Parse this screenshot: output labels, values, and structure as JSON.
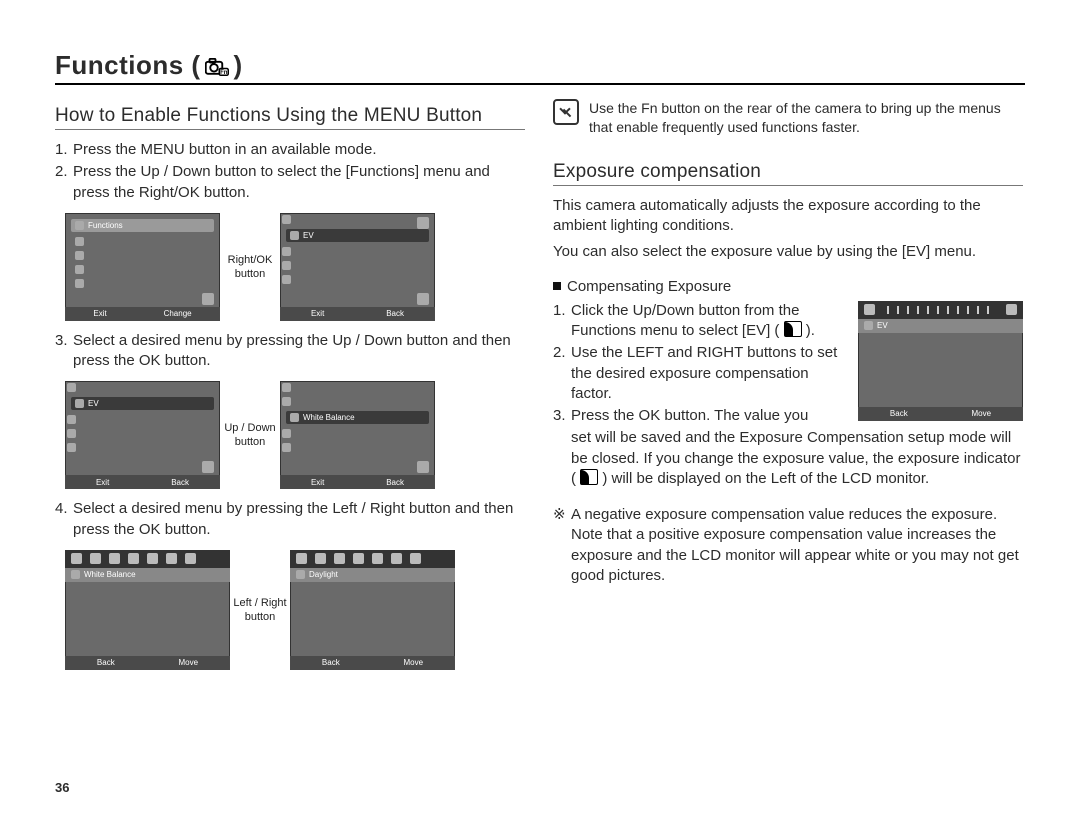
{
  "page_number": "36",
  "title": {
    "text": "Functions (",
    "icon_name": "camera-fn-icon",
    "close": ")"
  },
  "left": {
    "subhead": "How to Enable Functions Using the MENU Button",
    "steps": {
      "s1": "Press the MENU button in an available mode.",
      "s2": "Press the Up / Down button to select the [Functions] menu and press the Right/OK button.",
      "s3": "Select a desired menu by pressing the Up / Down button and then press the OK button.",
      "s4": "Select a desired menu by pressing the Left / Right button and then press the OK button."
    },
    "ann": {
      "rightok_l1": "Right/OK",
      "rightok_l2": "button",
      "updown_l1": "Up / Down",
      "updown_l2": "button",
      "leftright_l1": "Left / Right",
      "leftright_l2": "button"
    },
    "screens": {
      "a": {
        "title": "Functions",
        "footer_left": "Exit",
        "footer_right": "Change"
      },
      "b": {
        "title": "EV",
        "footer_left": "Exit",
        "footer_right": "Back"
      },
      "c": {
        "title": "EV",
        "footer_left": "Exit",
        "footer_right": "Back"
      },
      "d": {
        "title": "White Balance",
        "footer_left": "Exit",
        "footer_right": "Back"
      },
      "e": {
        "menubar": "White Balance",
        "footer_left": "Back",
        "footer_right": "Move"
      },
      "f": {
        "menubar": "Daylight",
        "footer_left": "Back",
        "footer_right": "Move"
      }
    }
  },
  "right": {
    "note": "Use the Fn button on the rear of the camera to bring up the menus that enable frequently used functions faster.",
    "subhead": "Exposure compensation",
    "intro1": "This camera automatically adjusts the exposure according to the ambient lighting conditions.",
    "intro2": "You can also select the exposure value by using the [EV] menu.",
    "bullet": "Compensating Exposure",
    "steps": {
      "s1a": "Click the Up/Down button from the",
      "s1b": "Functions menu to select [EV] (",
      "s1c": ").",
      "s2": "Use the LEFT and RIGHT buttons to set the desired exposure compensation factor.",
      "s3a": "Press the OK button. The value you",
      "s3b": "set will be saved and the Exposure Compensation setup mode will be closed. If you change the exposure value, the exposure indicator (",
      "s3c": ") will be displayed on the Left of the LCD monitor."
    },
    "screen": {
      "menubar": "EV",
      "footer_left": "Back",
      "footer_right": "Move"
    },
    "star_note": "A negative exposure compensation value reduces the exposure. Note that a positive exposure compensation value increases the exposure and the LCD monitor will appear white or you may not get good pictures."
  }
}
